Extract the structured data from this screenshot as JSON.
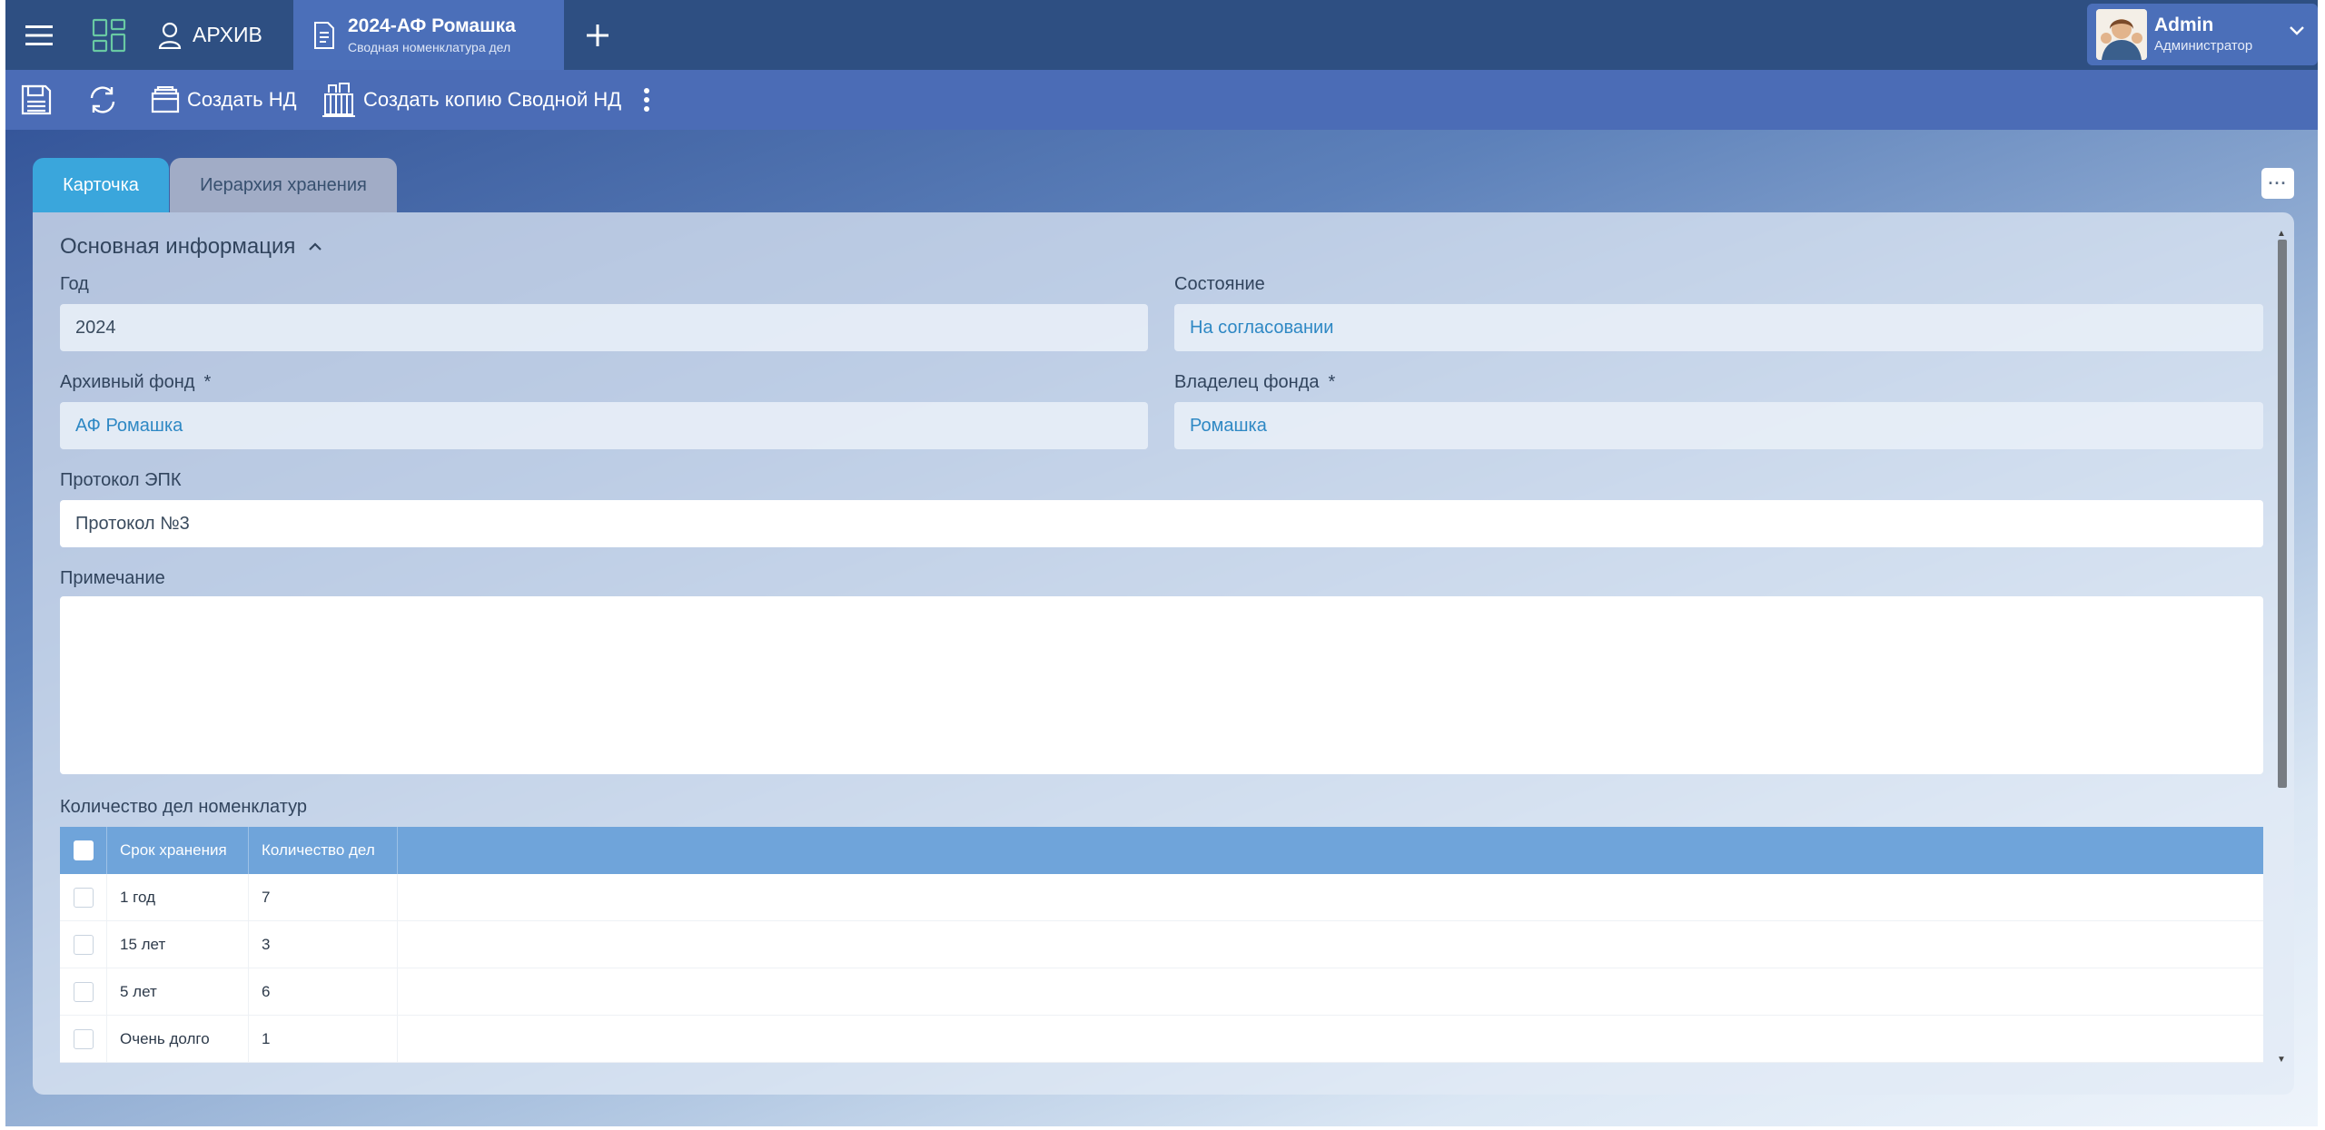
{
  "topbar": {
    "archive_label": "АРХИВ",
    "doc_tab": {
      "title": "2024-АФ Ромашка",
      "subtitle": "Сводная номенклатура дел"
    },
    "user": {
      "name": "Admin",
      "role": "Администратор"
    }
  },
  "toolbar": {
    "create_nd": "Создать НД",
    "create_copy": "Создать копию Сводной НД"
  },
  "tabs": {
    "card": "Карточка",
    "hierarchy": "Иерархия хранения"
  },
  "section": {
    "title": "Основная информация"
  },
  "fields": {
    "year": {
      "label": "Год",
      "value": "2024"
    },
    "state": {
      "label": "Состояние",
      "value": "На согласовании"
    },
    "fund": {
      "label": "Архивный фонд",
      "value": "АФ Ромашка",
      "required_mark": "*"
    },
    "owner": {
      "label": "Владелец фонда",
      "value": "Ромашка",
      "required_mark": "*"
    },
    "protocol": {
      "label": "Протокол ЭПК",
      "value": "Протокол №3"
    },
    "note": {
      "label": "Примечание",
      "value": ""
    }
  },
  "table": {
    "title": "Количество дел номенклатур",
    "headers": [
      "Срок хранения",
      "Количество дел"
    ],
    "rows": [
      [
        "1 год",
        "7"
      ],
      [
        "15 лет",
        "3"
      ],
      [
        "5 лет",
        "6"
      ],
      [
        "Очень долго",
        "1"
      ]
    ]
  },
  "colors": {
    "topbar": "#2e4f82",
    "toolbar": "#4b6cb6",
    "active_tab": "#3aa6dc",
    "table_header": "#6fa4da",
    "link": "#2e88c4"
  }
}
